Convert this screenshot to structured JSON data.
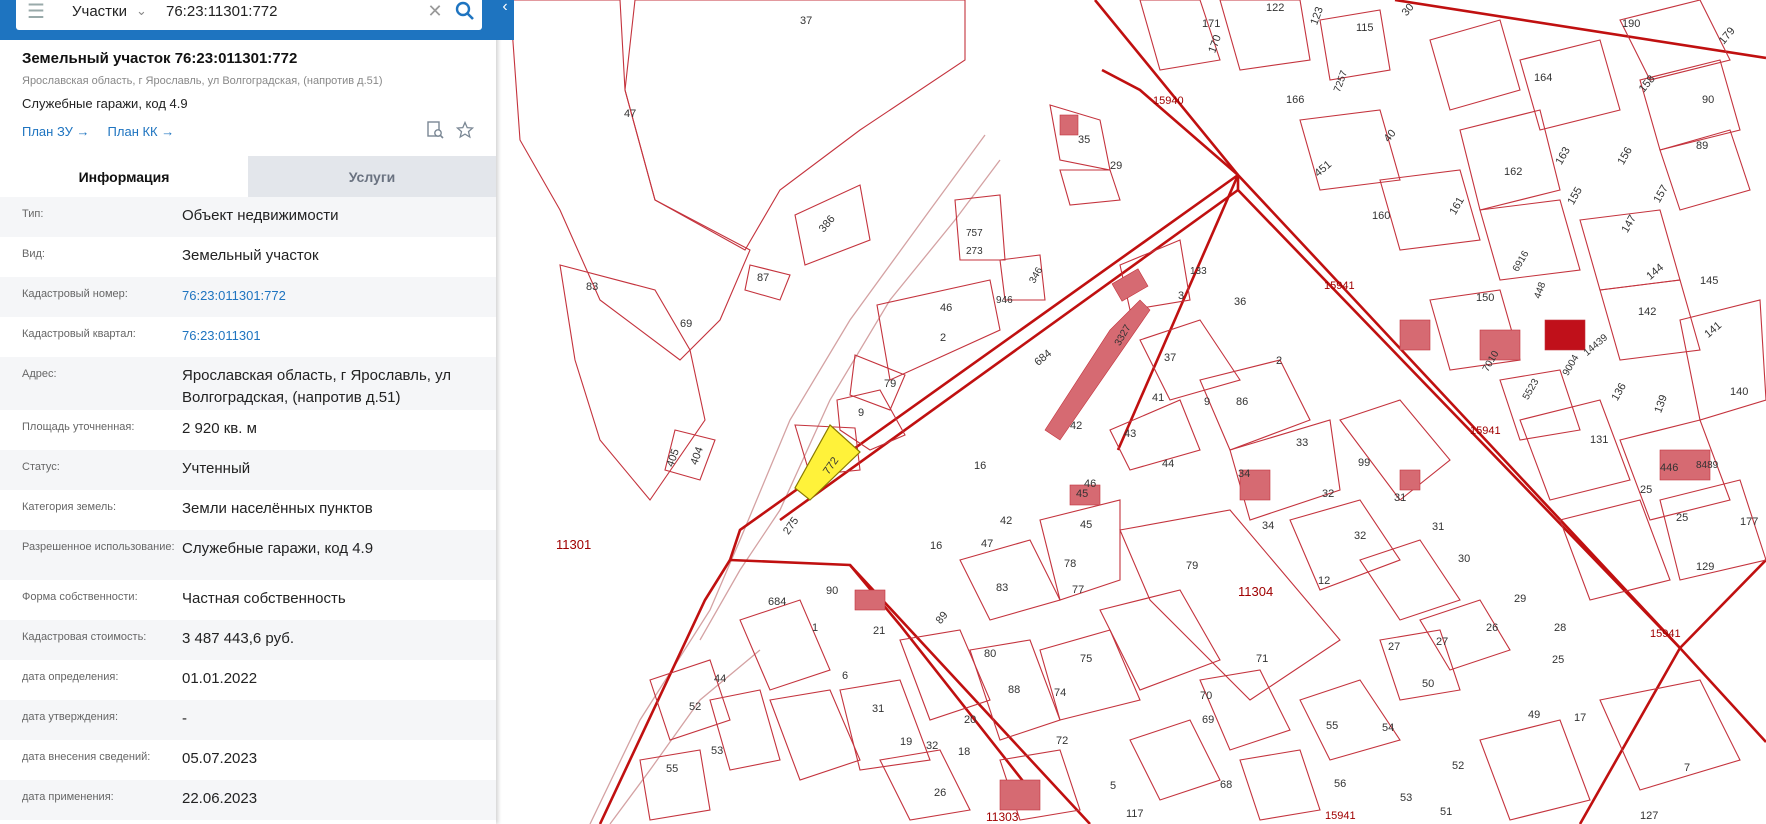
{
  "search": {
    "type_label": "Участки",
    "value": "76:23:11301:772"
  },
  "parcel": {
    "title": "Земельный участок 76:23:011301:772",
    "address_short": "Ярославская область, г Ярославль, ул Волгоградская, (напротив д.51)",
    "usage": "Служебные гаражи, код 4.9",
    "plan_zu": "План ЗУ →",
    "plan_kk": "План КК →"
  },
  "tabs": [
    "Информация",
    "Услуги"
  ],
  "info_rows": [
    {
      "label": "Тип:",
      "value": "Объект недвижимости"
    },
    {
      "label": "Вид:",
      "value": "Земельный участок"
    },
    {
      "label": "Кадастровый номер:",
      "value": "76:23:011301:772"
    },
    {
      "label": "Кадастровый квартал:",
      "value": "76:23:011301"
    },
    {
      "label": "Адрес:",
      "value": "Ярославская область, г Ярославль, ул Волгоградская, (напротив д.51)"
    },
    {
      "label": "Площадь уточненная:",
      "value": "2 920 кв. м"
    },
    {
      "label": "Статус:",
      "value": "Учтенный"
    },
    {
      "label": "Категория земель:",
      "value": "Земли населённых пунктов"
    },
    {
      "label": "Разрешенное использование:",
      "value": "Служебные гаражи, код 4.9"
    },
    {
      "label": "Форма собственности:",
      "value": "Частная собственность"
    },
    {
      "label": "Кадастровая стоимость:",
      "value": "3 487 443,6 руб."
    },
    {
      "label": "дата определения:",
      "value": "01.01.2022"
    },
    {
      "label": "дата утверждения:",
      "value": "-"
    },
    {
      "label": "дата внесения сведений:",
      "value": "05.07.2023"
    },
    {
      "label": "дата применения:",
      "value": "22.06.2023"
    }
  ],
  "map": {
    "quarter_labels": [
      "11301",
      "11304",
      "11303",
      "15940",
      "15941",
      "15941",
      "15941",
      "15941"
    ],
    "parcel_labels": [
      "37",
      "47",
      "171",
      "170",
      "122",
      "123",
      "115",
      "30",
      "190",
      "179",
      "7257",
      "166",
      "164",
      "158",
      "90",
      "40",
      "451",
      "162",
      "163",
      "156",
      "89",
      "160",
      "161",
      "155",
      "157",
      "147",
      "6916",
      "150",
      "144",
      "145",
      "142",
      "141",
      "448",
      "14439",
      "7010",
      "9004",
      "136",
      "5523",
      "140",
      "139",
      "131",
      "446",
      "8489",
      "25",
      "177",
      "129",
      "386",
      "87",
      "83",
      "69",
      "35",
      "29",
      "46",
      "2",
      "757",
      "273",
      "946",
      "346",
      "133",
      "3",
      "36",
      "37",
      "3327",
      "2",
      "41",
      "9",
      "86",
      "684",
      "42",
      "43",
      "33",
      "32",
      "79",
      "405",
      "404",
      "772",
      "275",
      "16",
      "45",
      "46",
      "44",
      "34",
      "99",
      "31",
      "31",
      "47",
      "42",
      "45",
      "34",
      "32",
      "11301",
      "16",
      "83",
      "78",
      "77",
      "79",
      "30",
      "29",
      "26",
      "28",
      "12",
      "27",
      "25",
      "684",
      "90",
      "89",
      "1",
      "21",
      "80",
      "88",
      "75",
      "71",
      "50",
      "49",
      "17",
      "6",
      "74",
      "70",
      "69",
      "31",
      "20",
      "19",
      "32",
      "18",
      "72",
      "55",
      "54",
      "52",
      "53",
      "68",
      "56",
      "53",
      "51",
      "55",
      "44",
      "26",
      "5",
      "7",
      "127",
      "117",
      "11303",
      "15941"
    ],
    "colors": {
      "boundary": "#c01010",
      "parcel": "#d0454f",
      "selected_fill": "#fff23a",
      "road": "#c9898a"
    }
  }
}
